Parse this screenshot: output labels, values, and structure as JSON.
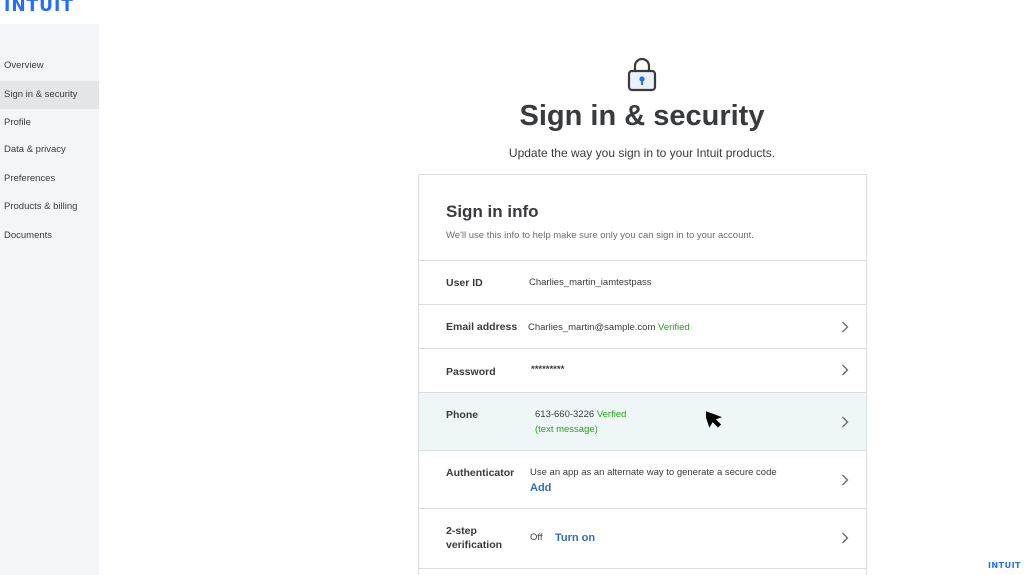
{
  "brand": {
    "logo_text": "INTUIT",
    "footer_logo_text": "INTUIT"
  },
  "sidebar": {
    "items": [
      {
        "label": "Overview"
      },
      {
        "label": "Sign in & security",
        "active": true
      },
      {
        "label": "Profile"
      },
      {
        "label": "Data & privacy"
      },
      {
        "label": "Preferences"
      },
      {
        "label": "Products & billing"
      },
      {
        "label": "Documents"
      }
    ]
  },
  "header": {
    "icon": "lock-icon",
    "title": "Sign in & security",
    "subtitle": "Update the way you sign in to your Intuit products."
  },
  "card": {
    "title": "Sign in info",
    "subtitle": "We'll use this info to help make sure only you can sign in to your account.",
    "rows": [
      {
        "label": "User ID",
        "value": "Charlies_martin_iamtestpass"
      },
      {
        "label": "Email address",
        "value": "Charlies_martin@sample.com",
        "status": "Verified"
      },
      {
        "label": "Password",
        "value": "*********"
      },
      {
        "label": "Phone",
        "value": "613-660-3226",
        "status": "Verfied",
        "note": "(text message)"
      },
      {
        "label": "Authenticator",
        "value": "Use an app as an alternate way to generate a secure code",
        "action": "Add"
      },
      {
        "label_line1": "2-step",
        "label_line2": "verification",
        "value": "Off",
        "action": "Turn on"
      }
    ]
  },
  "colors": {
    "brand_blue": "#236cff",
    "verified_green": "#2ca01c",
    "link_blue": "#2f6fb3",
    "highlight_row": "#eef6f7"
  },
  "icons": [
    "lock-icon",
    "chevron-right-icon",
    "mouse-cursor-icon"
  ]
}
